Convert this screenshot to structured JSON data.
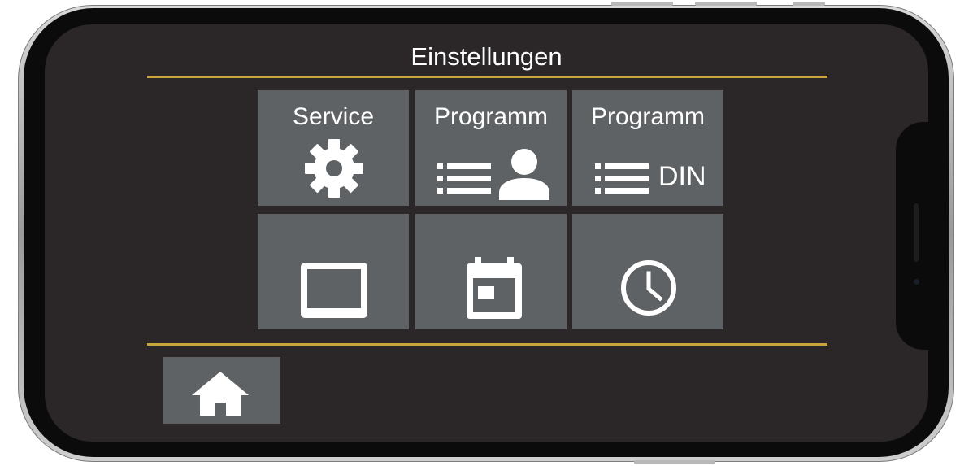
{
  "screen": {
    "title": "Einstellungen",
    "accent_color": "#c8a53a",
    "background_color": "#2b2627",
    "tile_color": "#5f6264"
  },
  "tiles": [
    {
      "label": "Service",
      "icon": "gear-icon"
    },
    {
      "label": "Programm",
      "icon": "list-user-icon"
    },
    {
      "label": "Programm",
      "icon": "list-icon",
      "suffix": "DIN"
    },
    {
      "label": "",
      "icon": "display-icon"
    },
    {
      "label": "",
      "icon": "calendar-icon"
    },
    {
      "label": "",
      "icon": "clock-icon"
    }
  ],
  "footer": {
    "home_icon": "home-icon"
  }
}
